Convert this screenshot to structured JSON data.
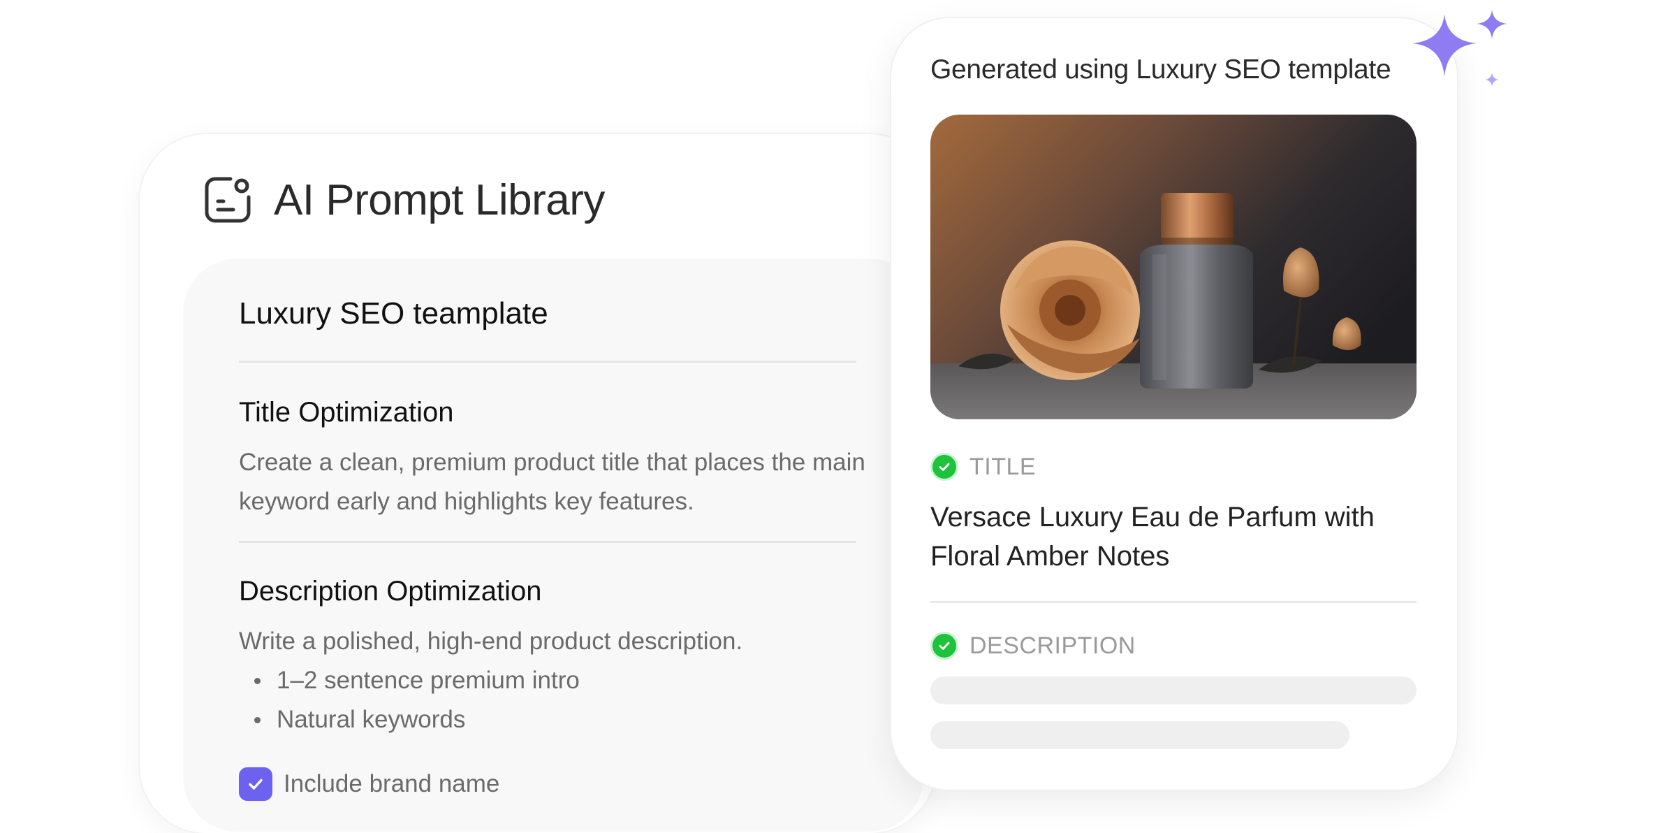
{
  "library": {
    "title": "AI Prompt Library",
    "icon": "prompt-library-icon",
    "template": {
      "name": "Luxury SEO teamplate",
      "sections": [
        {
          "title": "Title Optimization",
          "body": "Create a clean, premium product title that places the main keyword early and highlights key features."
        },
        {
          "title": "Description Optimization",
          "body": "Write a polished, high-end product description.",
          "bullets": [
            "1–2 sentence premium intro",
            "Natural keywords"
          ]
        }
      ],
      "options": [
        {
          "label": "Include brand name",
          "checked": true
        }
      ]
    }
  },
  "result": {
    "heading": "Generated using Luxury SEO template",
    "image": "perfume-bottle-with-flowers",
    "fields": [
      {
        "label": "TITLE",
        "status": "done",
        "value": "Versace Luxury Eau de Parfum with Floral Amber Notes"
      },
      {
        "label": "DESCRIPTION",
        "status": "done",
        "value": ""
      }
    ]
  },
  "colors": {
    "accent": "#6d62f0",
    "success": "#1ec33b",
    "sparkle": "#8f7cf3"
  }
}
